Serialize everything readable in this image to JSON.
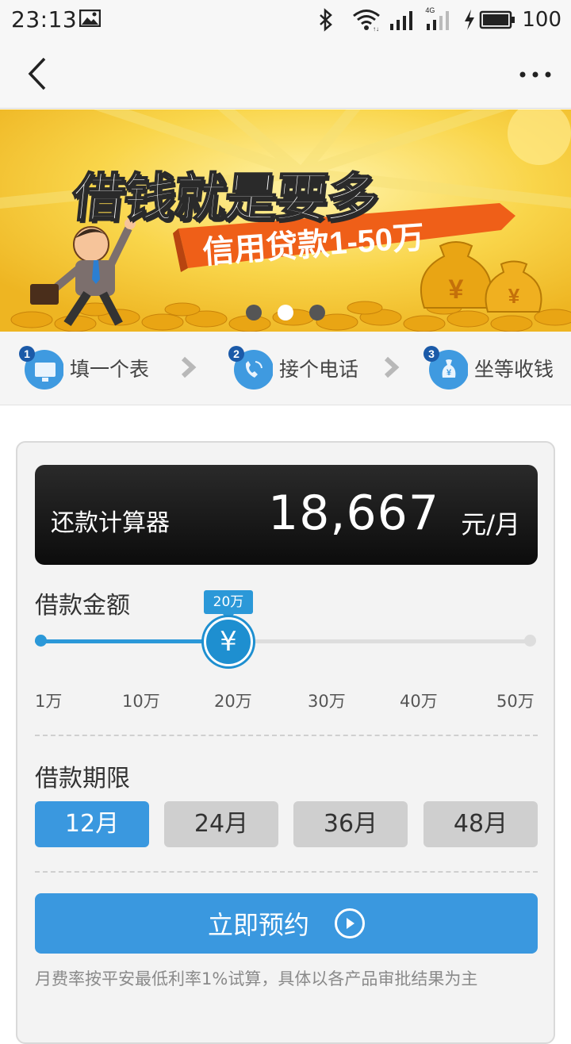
{
  "status_bar": {
    "time": "23:13",
    "network": "4G",
    "battery": "100",
    "icons": [
      "image-icon",
      "bluetooth-icon",
      "wifi-icon",
      "signal-icon",
      "signal-4g-icon",
      "charging-icon",
      "battery-icon"
    ]
  },
  "nav": {
    "back_icon": "chevron-left-icon",
    "more_icon": "more-dots-icon"
  },
  "banner": {
    "headline": "借钱就是要多",
    "subline": "信用贷款1-50万",
    "slide_count": 3,
    "active_slide": 2
  },
  "steps": [
    {
      "number": "1",
      "label": "填一个表",
      "icon": "form-icon"
    },
    {
      "number": "2",
      "label": "接个电话",
      "icon": "phone-icon"
    },
    {
      "number": "3",
      "label": "坐等收钱",
      "icon": "money-bag-icon"
    }
  ],
  "calculator": {
    "title": "还款计算器",
    "amount": "18,667",
    "unit": "元/月"
  },
  "loan_amount": {
    "label": "借款金额",
    "selected_label": "20万",
    "selected_fraction": 0.388,
    "thumb_symbol": "¥",
    "ticks": [
      "1万",
      "10万",
      "20万",
      "30万",
      "40万",
      "50万"
    ]
  },
  "loan_term": {
    "label": "借款期限",
    "options": [
      "12月",
      "24月",
      "36月",
      "48月"
    ],
    "selected_index": 0
  },
  "apply_button": {
    "label": "立即预约"
  },
  "disclaimer": "月费率按平安最低利率1%试算，具体以各产品审批结果为主",
  "colors": {
    "accent": "#3a98df",
    "slider": "#2b98d8",
    "banner_yellow": "#f6c42f",
    "banner_orange": "#f06a1e"
  }
}
